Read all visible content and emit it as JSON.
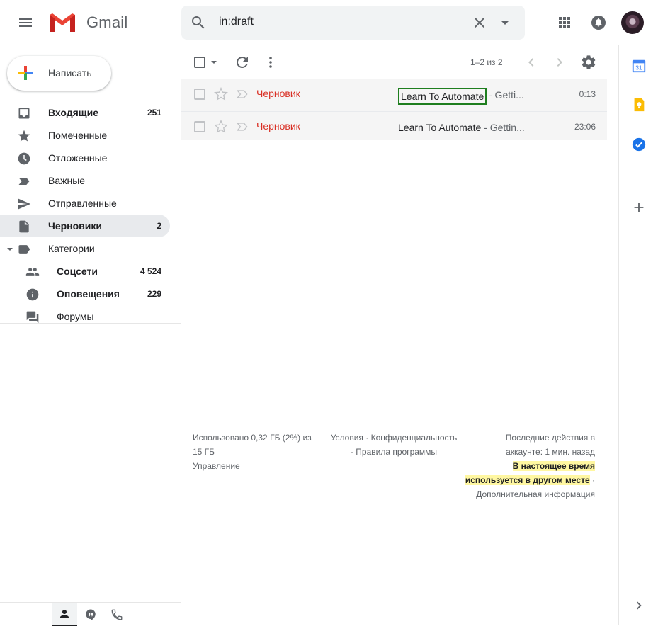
{
  "header": {
    "menu_icon": "hamburger-menu-icon",
    "logo_text": "Gmail",
    "search": {
      "value": "in:draft"
    },
    "colors": {
      "search_bg": "#f1f3f4"
    }
  },
  "sidebar": {
    "compose_label": "Написать",
    "items": [
      {
        "label": "Входящие",
        "count": "251",
        "bold": true,
        "icon": "inbox-icon"
      },
      {
        "label": "Помеченные",
        "count": "",
        "icon": "star-icon"
      },
      {
        "label": "Отложенные",
        "count": "",
        "icon": "clock-icon"
      },
      {
        "label": "Важные",
        "count": "",
        "icon": "important-label-icon"
      },
      {
        "label": "Отправленные",
        "count": "",
        "icon": "send-icon"
      },
      {
        "label": "Черновики",
        "count": "2",
        "bold": true,
        "active": true,
        "icon": "draft-file-icon"
      },
      {
        "label": "Категории",
        "count": "",
        "icon": "label-icon"
      },
      {
        "label": "Соцсети",
        "count": "4 524",
        "bold": true,
        "icon": "people-icon"
      },
      {
        "label": "Оповещения",
        "count": "229",
        "bold": true,
        "icon": "info-icon"
      },
      {
        "label": "Форумы",
        "count": "",
        "icon": "forum-icon"
      }
    ]
  },
  "toolbar": {
    "range": "1–2 из 2"
  },
  "mails": [
    {
      "sender": "Черновик",
      "subject": "Learn To Automate",
      "snippet": " - Getti...",
      "time": "0:13"
    },
    {
      "sender": "Черновик",
      "subject": "Learn To Automate",
      "snippet": " - Gettin...",
      "time": "23:06"
    }
  ],
  "footer": {
    "storage_line1": "Использовано 0,32 ГБ (2%) из",
    "storage_line2": "15 ГБ",
    "manage": "Управление",
    "terms_line1": "Условия · Конфиденциальность",
    "terms_line2": "· Правила программы",
    "activity_line1": "Последние действия в",
    "activity_line2": "аккаунте: 1 мин. назад",
    "notice_line1": "В настоящее время",
    "notice_line2": "используется в другом месте",
    "notice_sep": " ·",
    "details": "Дополнительная информация"
  },
  "side_panel": {
    "icons": [
      "calendar-icon",
      "keep-icon",
      "tasks-icon",
      "add-addon-icon",
      "expand-panel-icon"
    ],
    "calendar_day": "31"
  },
  "colors": {
    "draft_red": "#d93025",
    "active_nav_bg": "#e8eaed",
    "focus_box": "#1e7e1e",
    "highlight": "#fff7a1"
  }
}
